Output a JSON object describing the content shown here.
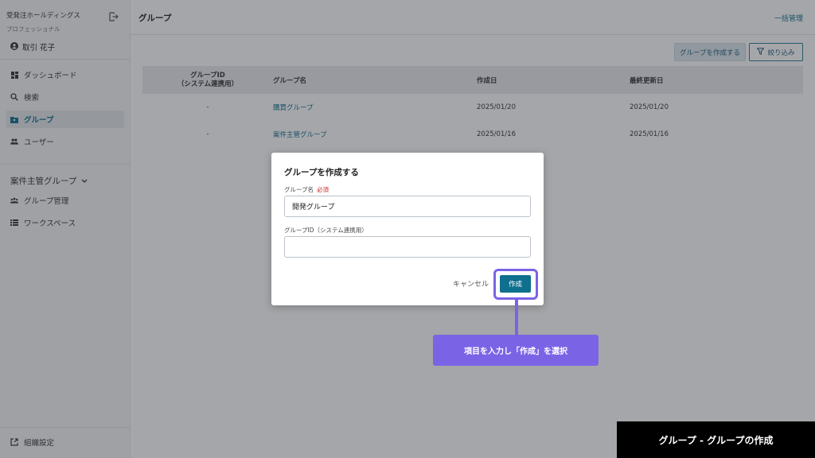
{
  "sidebar": {
    "org_name": "受発注ホールディングス",
    "org_plan": "プロフェッショナル",
    "user_name": "取引 花子",
    "items": [
      {
        "label": "ダッシュボード"
      },
      {
        "label": "検索"
      },
      {
        "label": "グループ"
      },
      {
        "label": "ユーザー"
      }
    ],
    "section_title": "案件主管グループ",
    "section_items": [
      {
        "label": "グループ管理"
      },
      {
        "label": "ワークスペース"
      }
    ],
    "footer_label": "組織設定"
  },
  "header": {
    "title": "グループ",
    "bulk_link": "一括管理"
  },
  "toolbar": {
    "create_label": "グループを作成する",
    "filter_label": "絞り込み"
  },
  "table": {
    "headers": [
      "グループID\n（システム連携用）",
      "グループ名",
      "作成日",
      "最終更新日"
    ],
    "header_id_line1": "グループID",
    "header_id_line2": "（システム連携用）",
    "rows": [
      {
        "id": "-",
        "name": "購買グループ",
        "created": "2025/01/20",
        "updated": "2025/01/20"
      },
      {
        "id": "-",
        "name": "案件主管グループ",
        "created": "2025/01/16",
        "updated": "2025/01/16"
      }
    ]
  },
  "dialog": {
    "title": "グループを作成する",
    "name_label": "グループ名",
    "required_label": "必須",
    "name_value": "開発グループ",
    "id_label": "グループID（システム連携用）",
    "id_value": "",
    "cancel_label": "キャンセル",
    "create_label": "作成"
  },
  "callout": {
    "text": "項目を入力し「作成」を選択"
  },
  "caption": {
    "text": "グループ - グループの作成"
  },
  "colors": {
    "accent": "#0f6f8e",
    "highlight": "#7b63e6",
    "required": "#c62828"
  }
}
